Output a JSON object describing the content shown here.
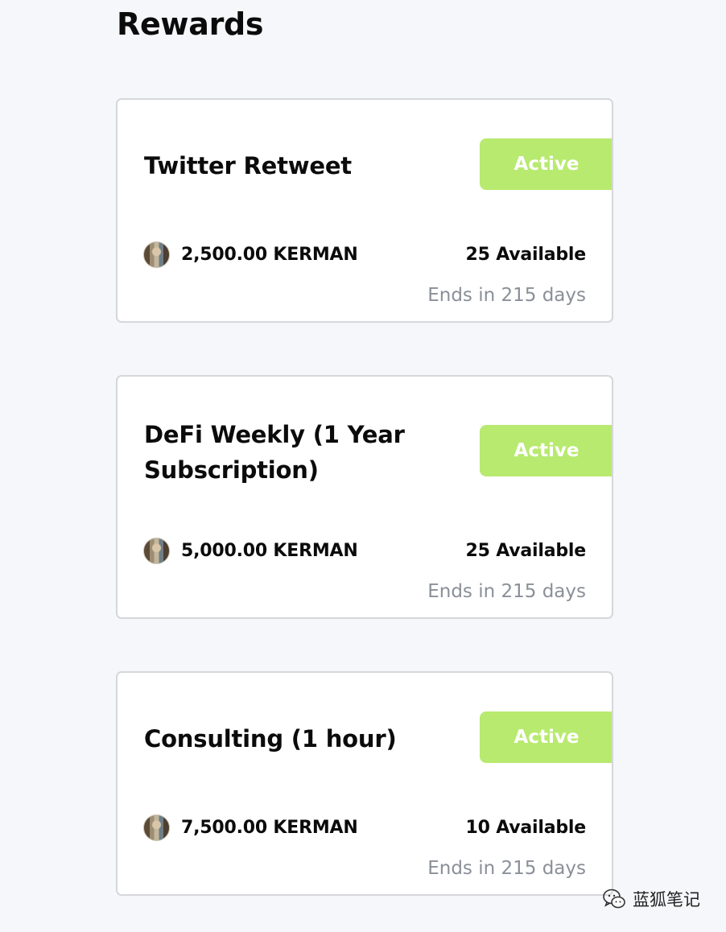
{
  "page": {
    "title": "Rewards"
  },
  "rewards": [
    {
      "title": "Twitter Retweet",
      "status": "Active",
      "price": "2,500.00 KERMAN",
      "available": "25 Available",
      "ends": "Ends in 215 days"
    },
    {
      "title": "DeFi Weekly (1 Year Subscription)",
      "status": "Active",
      "price": "5,000.00 KERMAN",
      "available": "25 Available",
      "ends": "Ends in 215 days"
    },
    {
      "title": "Consulting (1 hour)",
      "status": "Active",
      "price": "7,500.00 KERMAN",
      "available": "10 Available",
      "ends": "Ends in 215 days"
    }
  ],
  "watermark": {
    "text": "蓝狐笔记",
    "icon": "wechat-icon"
  },
  "colors": {
    "background": "#f6f7fb",
    "card_border": "#d6d7db",
    "badge_green": "#b7ea6f",
    "muted_text": "#8a8f98"
  }
}
